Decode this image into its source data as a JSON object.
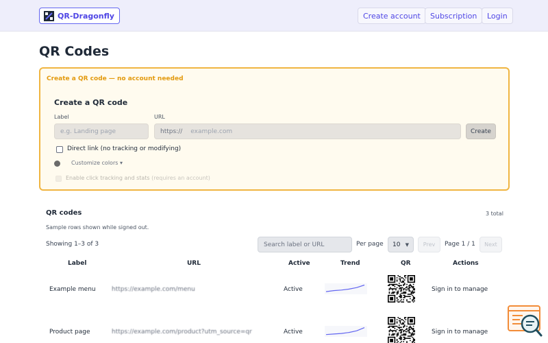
{
  "header": {
    "brand_name": "QR-Dragonfly",
    "brand_icon": "qr-dragonfly-logo",
    "nav": [
      "Create account",
      "Subscription",
      "Login"
    ]
  },
  "page": {
    "title": "QR Codes"
  },
  "create_panel": {
    "heading": "Create a QR code — no account needed",
    "form_title": "Create a QR code",
    "label_field": {
      "label": "Label",
      "placeholder": "e.g. Landing page",
      "value": ""
    },
    "url_field": {
      "label": "URL",
      "prefix": "https://",
      "placeholder": "example.com",
      "value": ""
    },
    "create_button": "Create",
    "direct_link": {
      "label": "Direct link (no tracking or modifying)",
      "checked": false
    },
    "customize_colors": "Customize colors ▾",
    "tracking": {
      "label": "Enable click tracking and stats",
      "note": "(requires an account)",
      "enabled": false
    }
  },
  "list": {
    "title": "QR codes",
    "total": "3 total",
    "note": "Sample rows shown while signed out.",
    "showing": "Showing 1–3 of 3",
    "search_placeholder": "Search label or URL",
    "per_page_label": "Per page",
    "per_page_value": "10",
    "prev": "Prev",
    "next": "Next",
    "page_indicator": "Page 1 / 1",
    "columns": [
      "Label",
      "URL",
      "Active",
      "Trend",
      "QR",
      "Actions"
    ],
    "rows": [
      {
        "label": "Example menu",
        "url": "https://example.com/menu",
        "active": "Active",
        "trend": [
          2,
          3,
          3.5,
          4.5,
          6,
          8.5
        ],
        "action": "Sign in to manage"
      },
      {
        "label": "Product page",
        "url": "https://example.com/product?utm_source=qr",
        "active": "Active",
        "trend": [
          1.5,
          2,
          2.5,
          3.5,
          5,
          8
        ],
        "action": "Sign in to manage"
      }
    ]
  },
  "colors": {
    "accent": "#4f46e5",
    "panel_border": "#f0b541",
    "panel_heading": "#e39a0e",
    "trend_line": "#6366f1"
  },
  "help_icon": "chat-search-icon"
}
